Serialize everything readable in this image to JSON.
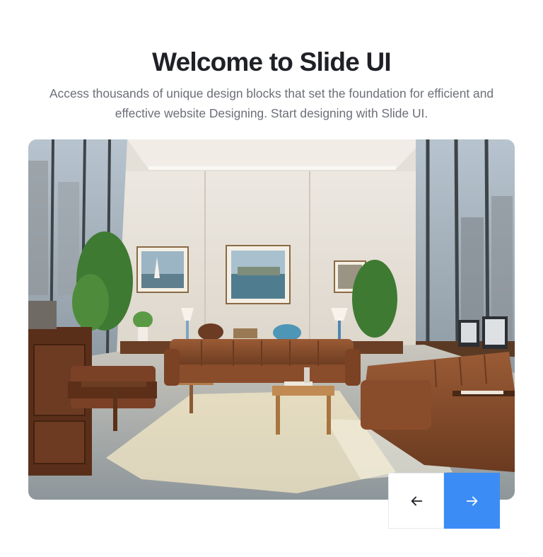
{
  "header": {
    "title": "Welcome to Slide UI",
    "subtitle": "Access thousands of unique design blocks that set the foundation for efficient and effective website Designing. Start designing with Slide UI."
  },
  "slider": {
    "current_image": "modern-office-lounge-photo",
    "prev_icon": "arrow-left-icon",
    "next_icon": "arrow-right-icon"
  },
  "colors": {
    "title": "#1f2126",
    "subtitle": "#6b6f77",
    "accent": "#3c8cf5",
    "prev_button_bg": "#ffffff"
  }
}
